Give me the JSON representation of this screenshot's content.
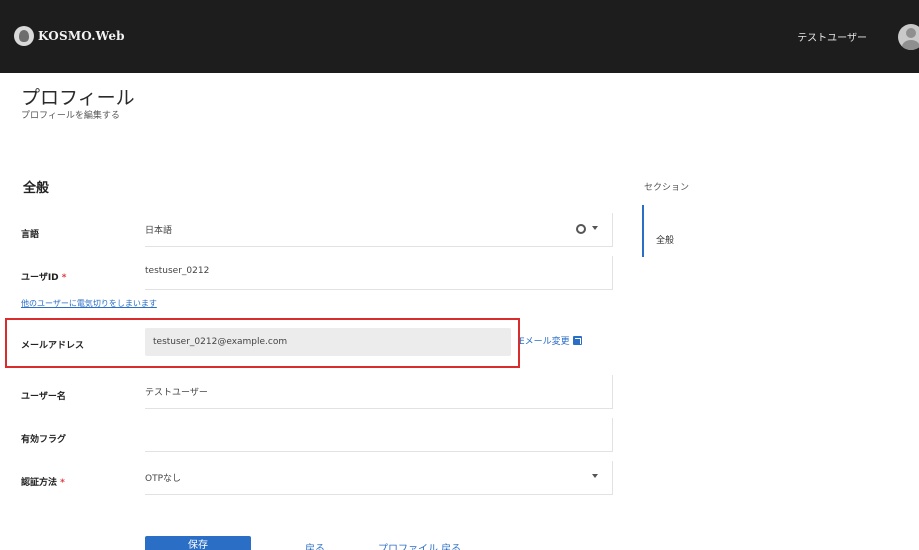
{
  "header": {
    "logo_text": "KOSMO.Web",
    "user_name": "テストユーザー"
  },
  "page": {
    "title": "プロフィール",
    "subtitle": "プロフィールを編集する"
  },
  "section": {
    "title": "全般"
  },
  "fields": {
    "language": {
      "label": "言語",
      "value": "日本語"
    },
    "user_id": {
      "label": "ユーザID",
      "required_mark": "*",
      "value": "testuser_0212"
    },
    "reset_link": "他のユーザーに電気切りをしまいます",
    "email": {
      "label": "メールアドレス",
      "value": "testuser_0212@example.com",
      "change_label": "Eメール変更"
    },
    "user_name": {
      "label": "ユーザー名",
      "value": "テストユーザー"
    },
    "flag": {
      "label": "有効フラグ",
      "value": ""
    },
    "auth": {
      "label": "認証方法",
      "required_mark": "*",
      "value": "OTPなし"
    }
  },
  "sidebar": {
    "heading": "セクション",
    "items": [
      {
        "label": "全般"
      }
    ]
  },
  "actions": {
    "save": "保存",
    "back": "戻る",
    "reset": "プロファイル 戻る"
  },
  "colors": {
    "topbar": "#1d1d1d",
    "accent": "#2b6ec6",
    "highlight": "#d92c2c",
    "required": "#e03b3b"
  }
}
